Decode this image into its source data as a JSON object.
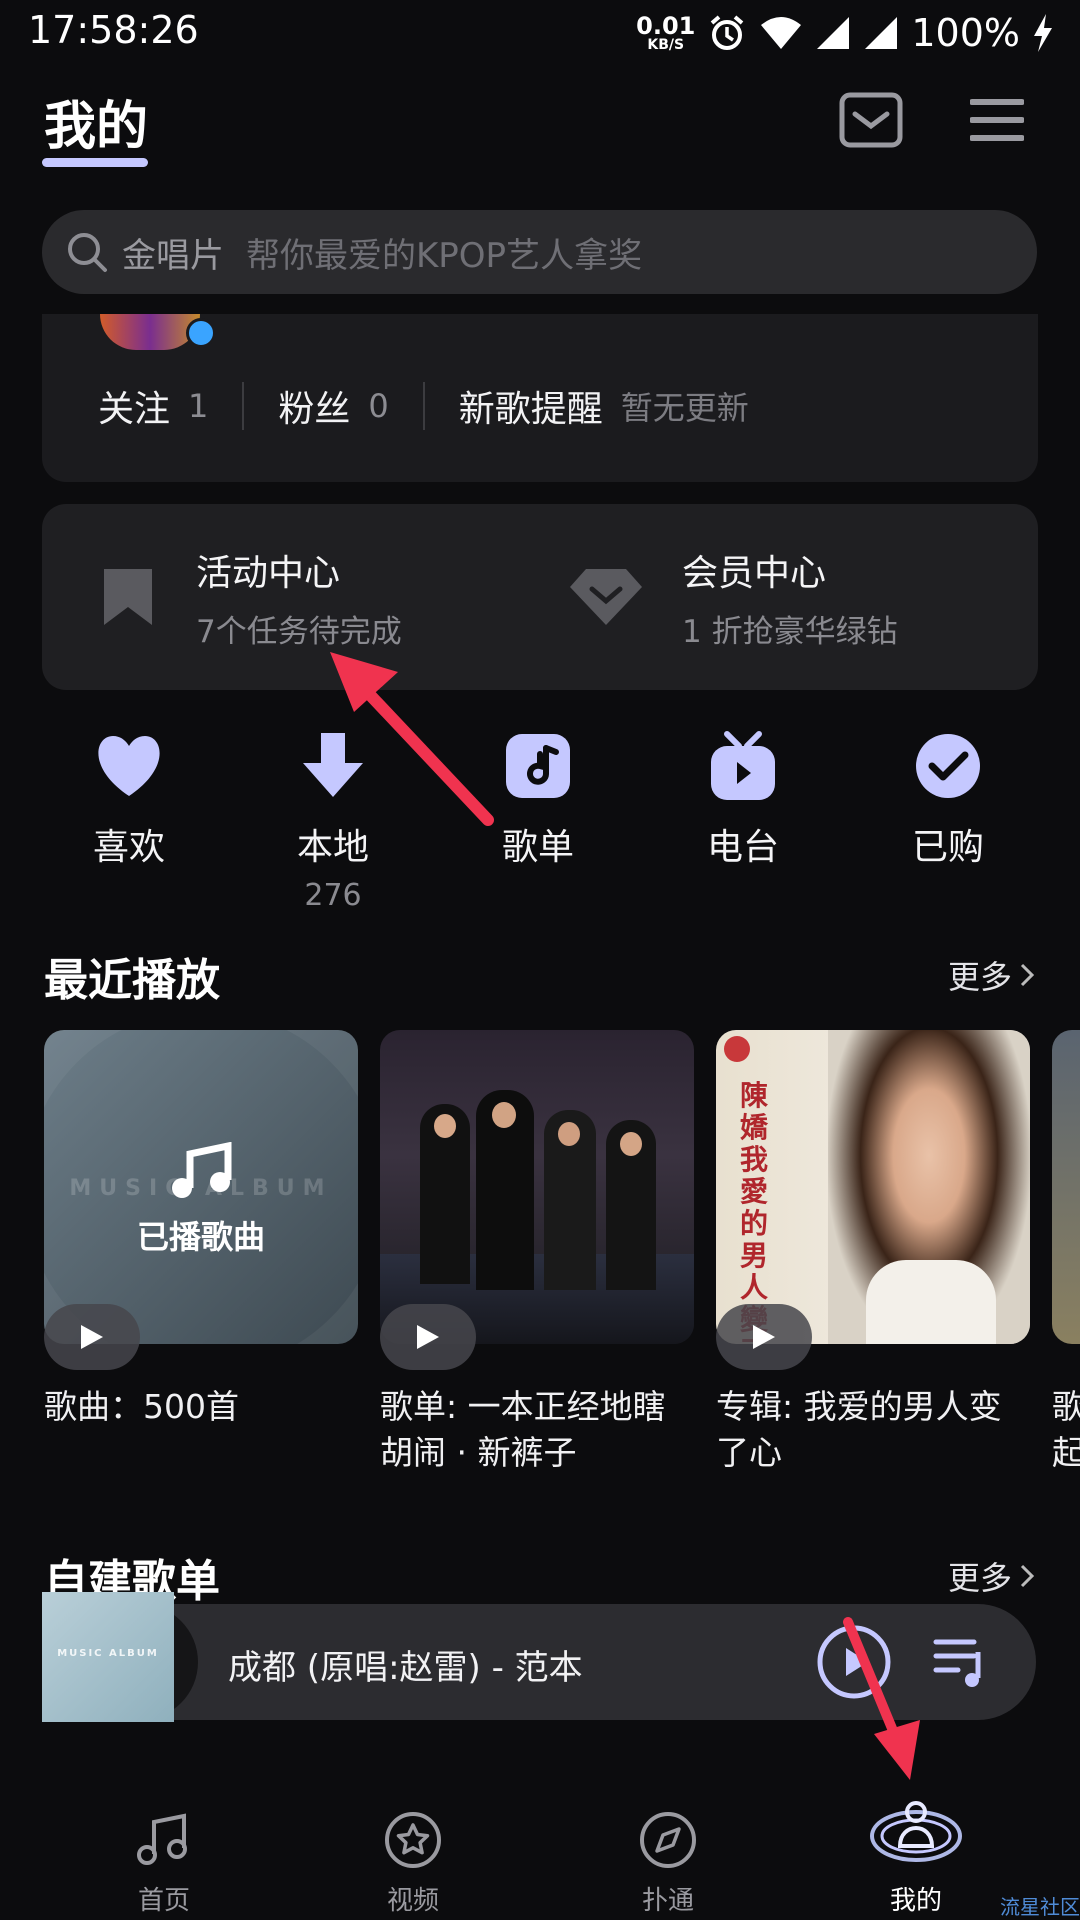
{
  "status_bar": {
    "time": "17:58:26",
    "net_speed": "0.01",
    "net_unit": "KB/S",
    "battery": "100%"
  },
  "header": {
    "title": "我的"
  },
  "search": {
    "hot_word": "金唱片",
    "placeholder": "帮你最爱的KPOP艺人拿奖"
  },
  "profile": {
    "stats": [
      {
        "label": "关注",
        "value": "1"
      },
      {
        "label": "粉丝",
        "value": "0"
      }
    ],
    "new_song": {
      "label": "新歌提醒",
      "status": "暂无更新"
    }
  },
  "activity": {
    "items": [
      {
        "title": "活动中心",
        "subtitle": "7个任务待完成",
        "icon": "bookmark-icon"
      },
      {
        "title": "会员中心",
        "subtitle": "1 折抢豪华绿钻",
        "icon": "diamond-icon"
      }
    ]
  },
  "quick_actions": [
    {
      "label": "喜欢",
      "icon": "heart-icon",
      "count": ""
    },
    {
      "label": "本地",
      "icon": "download-icon",
      "count": "276"
    },
    {
      "label": "歌单",
      "icon": "music-note-icon",
      "count": ""
    },
    {
      "label": "电台",
      "icon": "radio-tv-icon",
      "count": ""
    },
    {
      "label": "已购",
      "icon": "check-circle-icon",
      "count": ""
    }
  ],
  "recent": {
    "title": "最近播放",
    "more": "更多",
    "cards": [
      {
        "cover_text": "已播歌曲",
        "cover_watermark": "MUSIC ALBUM",
        "line1": "歌曲：500首",
        "line2": ""
      },
      {
        "line1": "歌单: 一本正经地瞎",
        "line2": "胡闹 · 新裤子"
      },
      {
        "line1": "专辑: 我爱的男人变",
        "line2": "了心",
        "cover_text": "陳嬌 我愛的男人變了"
      },
      {
        "line1": "歌",
        "line2": "起"
      }
    ]
  },
  "custom_playlists": {
    "title": "自建歌单",
    "more": "更多"
  },
  "player": {
    "cover_text": "MUSIC ALBUM",
    "title": "成都 (原唱:赵雷) - 范本"
  },
  "bottom_nav": [
    {
      "label": "首页",
      "icon": "music-note-icon",
      "active": false
    },
    {
      "label": "视频",
      "icon": "star-circle-icon",
      "active": false
    },
    {
      "label": "扑通",
      "icon": "compass-icon",
      "active": false
    },
    {
      "label": "我的",
      "icon": "profile-planet-icon",
      "active": true
    }
  ],
  "watermark": "流星社区",
  "colors": {
    "background": "#0c0c0e",
    "accent": "#c5c8ff",
    "annotation_arrow": "#f0334f"
  }
}
